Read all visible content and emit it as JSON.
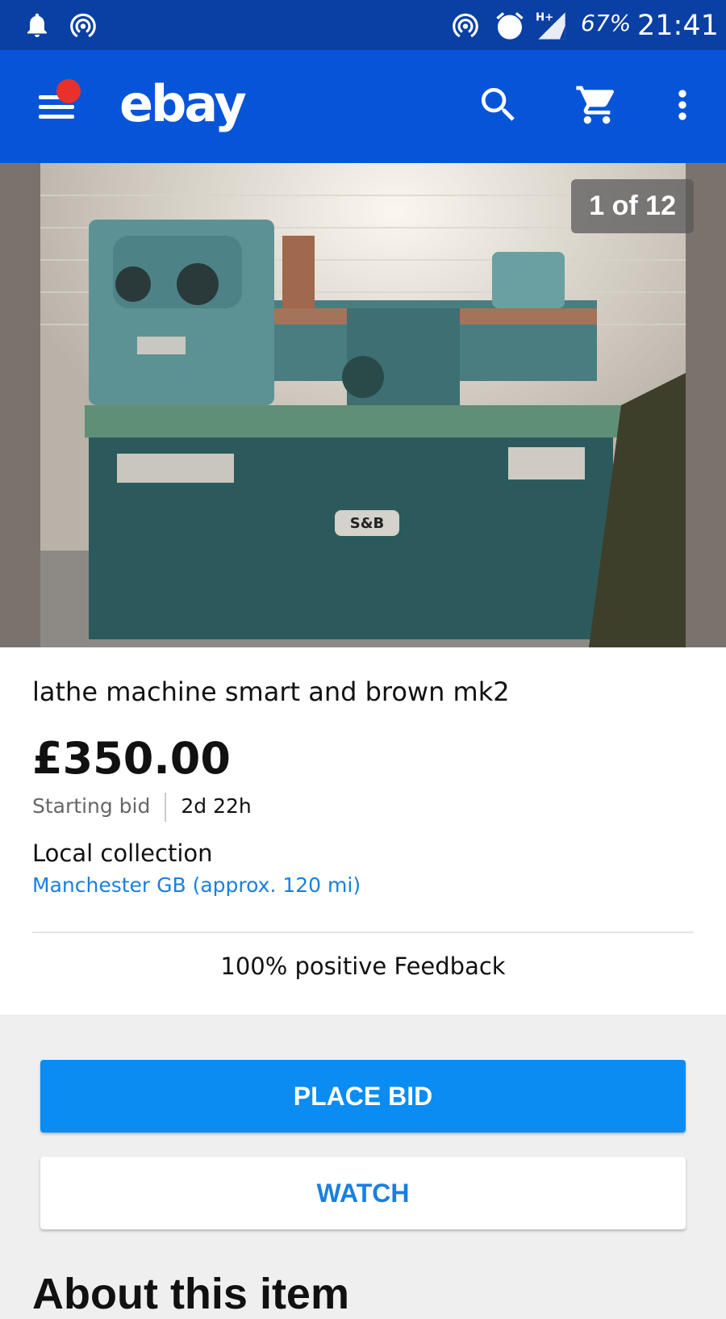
{
  "status_bar": {
    "battery": "67%",
    "time": "21:41",
    "network": "H+"
  },
  "app_bar": {
    "logo": "ebay",
    "icons": [
      "menu-icon",
      "search-icon",
      "cart-icon",
      "more-vert-icon"
    ]
  },
  "gallery": {
    "counter": "1 of 12",
    "badge_text": "S&B"
  },
  "listing": {
    "title": "lathe machine smart and brown mk2",
    "price": "£350.00",
    "price_label": "Starting bid",
    "time_left": "2d 22h",
    "delivery_label": "Local collection",
    "location": "Manchester GB (approx. 120 mi)",
    "feedback": "100% positive Feedback"
  },
  "actions": {
    "place_bid": "PLACE BID",
    "watch": "WATCH"
  },
  "section": {
    "about": "About this item"
  },
  "colors": {
    "status_bar": "#0a3fa3",
    "app_bar": "#0654d8",
    "primary_button": "#0a8cf2",
    "link": "#1a7fe0",
    "notification": "#e8312a"
  }
}
